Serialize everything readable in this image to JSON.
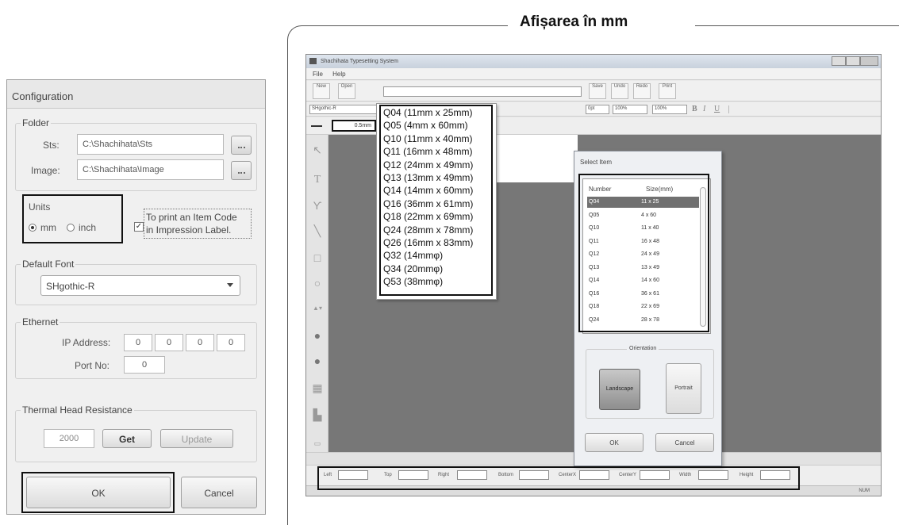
{
  "heading": "Afișarea în mm",
  "config": {
    "title": "Configuration",
    "folder": {
      "title": "Folder",
      "sts_label": "Sts:",
      "sts_value": "C:\\Shachihata\\Sts",
      "image_label": "Image:",
      "image_value": "C:\\Shachihata\\Image"
    },
    "units": {
      "title": "Units",
      "mm_label": "mm",
      "inch_label": "inch",
      "selected": "mm"
    },
    "print_item_code": {
      "checked": true,
      "line1": "To print an Item Code",
      "line2": "in Impression Label."
    },
    "default_font": {
      "title": "Default Font",
      "value": "SHgothic-R"
    },
    "ethernet": {
      "title": "Ethernet",
      "ip_label": "IP Address:",
      "ip": [
        "0",
        "0",
        "0",
        "0"
      ],
      "port_label": "Port No:",
      "port": "0"
    },
    "thermal": {
      "title": "Thermal Head Resistance",
      "value": "2000",
      "get_label": "Get",
      "update_label": "Update"
    },
    "ok_label": "OK",
    "cancel_label": "Cancel"
  },
  "app": {
    "title": "Shachihata Typesetting System",
    "menu": [
      "File",
      "Help"
    ],
    "toolbar": {
      "new": "New",
      "open": "Open",
      "save": "Save",
      "undo": "Undo",
      "redo": "Redo",
      "print": "Print"
    },
    "font_combo": "SHgothic-R",
    "line_width": "0.5mm",
    "size_values": [
      "0pt",
      "100%",
      "100%"
    ],
    "format_glyphs": [
      "B",
      "I",
      "U"
    ],
    "bottom_labels": [
      "Left",
      "Top",
      "Right",
      "Bottom",
      "CenterX",
      "CenterY",
      "Width",
      "Height"
    ],
    "status_right": "NUM"
  },
  "size_dropdown": {
    "items": [
      "Q04 (11mm x 25mm)",
      "Q05 (4mm x 60mm)",
      "Q10 (11mm x 40mm)",
      "Q11 (16mm x 48mm)",
      "Q12 (24mm x 49mm)",
      "Q13 (13mm x 49mm)",
      "Q14 (14mm x 60mm)",
      "Q16 (36mm x 61mm)",
      "Q18 (22mm x 69mm)",
      "Q24 (28mm x 78mm)",
      "Q26 (16mm x 83mm)",
      "Q32 (14mmφ)",
      "Q34 (20mmφ)",
      "Q53 (38mmφ)"
    ]
  },
  "select_item": {
    "title": "Select Item",
    "col_number": "Number",
    "col_size": "Size(mm)",
    "rows": [
      {
        "number": "Q04",
        "size": "11 x 25",
        "selected": true
      },
      {
        "number": "Q05",
        "size": "4 x 60"
      },
      {
        "number": "Q10",
        "size": "11 x 40"
      },
      {
        "number": "Q11",
        "size": "16 x 48"
      },
      {
        "number": "Q12",
        "size": "24 x 49"
      },
      {
        "number": "Q13",
        "size": "13 x 49"
      },
      {
        "number": "Q14",
        "size": "14 x 60"
      },
      {
        "number": "Q16",
        "size": "36 x 61"
      },
      {
        "number": "Q18",
        "size": "22 x 69"
      },
      {
        "number": "Q24",
        "size": "28 x 78"
      }
    ],
    "orientation_title": "Orientation",
    "landscape_label": "Landscape",
    "portrait_label": "Portrait",
    "ok_label": "OK",
    "cancel_label": "Cancel"
  }
}
